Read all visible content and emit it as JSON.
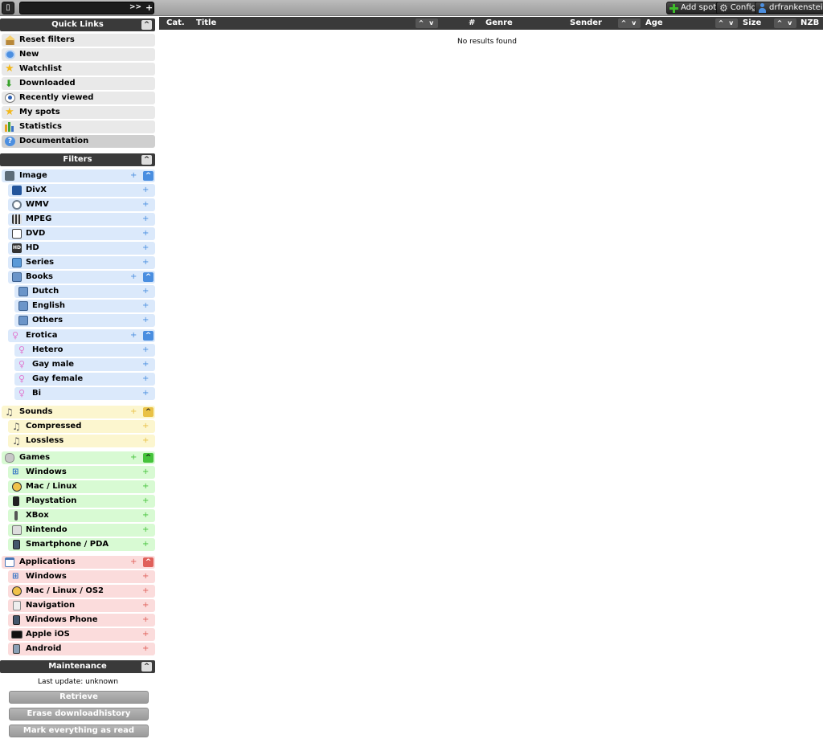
{
  "topbar": {
    "logo_glyph": "▯",
    "search": {
      "value": "",
      "go_label": ">>",
      "plus_label": "+"
    },
    "add_spot_label": "Add spot",
    "config_label": "Config",
    "user_label": "drfrankenstein"
  },
  "quick_links": {
    "header": "Quick Links",
    "items": [
      {
        "label": "Reset filters",
        "icon": "home-icon"
      },
      {
        "label": "New",
        "icon": "clock-icon"
      },
      {
        "label": "Watchlist",
        "icon": "star-icon"
      },
      {
        "label": "Downloaded",
        "icon": "download-arrow-icon"
      },
      {
        "label": "Recently viewed",
        "icon": "eye-icon"
      },
      {
        "label": "My spots",
        "icon": "star-icon"
      },
      {
        "label": "Statistics",
        "icon": "bar-chart-icon"
      },
      {
        "label": "Documentation",
        "icon": "help-icon"
      }
    ]
  },
  "filters": {
    "header": "Filters",
    "image": {
      "label": "Image",
      "children": [
        "DivX",
        "WMV",
        "MPEG",
        "DVD",
        "HD",
        "Series"
      ],
      "books": {
        "label": "Books",
        "children": [
          "Dutch",
          "English",
          "Others"
        ]
      },
      "erotica": {
        "label": "Erotica",
        "children": [
          "Hetero",
          "Gay male",
          "Gay female",
          "Bi"
        ]
      }
    },
    "sounds": {
      "label": "Sounds",
      "children": [
        "Compressed",
        "Lossless"
      ]
    },
    "games": {
      "label": "Games",
      "children": [
        "Windows",
        "Mac / Linux",
        "Playstation",
        "XBox",
        "Nintendo",
        "Smartphone / PDA"
      ]
    },
    "applications": {
      "label": "Applications",
      "children": [
        "Windows",
        "Mac / Linux / OS2",
        "Navigation",
        "Windows Phone",
        "Apple iOS",
        "Android"
      ]
    },
    "plus": "+",
    "collapse": "^"
  },
  "maintenance": {
    "header": "Maintenance",
    "last_update": "Last update: unknown",
    "retrieve_label": "Retrieve",
    "erase_label": "Erase downloadhistory",
    "mark_read_label": "Mark everything as read"
  },
  "columns": {
    "cat": "Cat.",
    "title": "Title",
    "hash": "#",
    "genre": "Genre",
    "sender": "Sender",
    "age": "Age",
    "size": "Size",
    "nzb": "NZB",
    "sort_glyph": "^ v"
  },
  "results": {
    "empty_message": "No results found"
  },
  "colors": {
    "image_bg": "#dbe9fb",
    "image_accent": "#4a8ee0",
    "sounds_bg": "#fcf6cf",
    "sounds_accent": "#e9c146",
    "games_bg": "#d8fad3",
    "games_accent": "#45c33b",
    "apps_bg": "#fbdcdc",
    "apps_accent": "#e0605a"
  }
}
